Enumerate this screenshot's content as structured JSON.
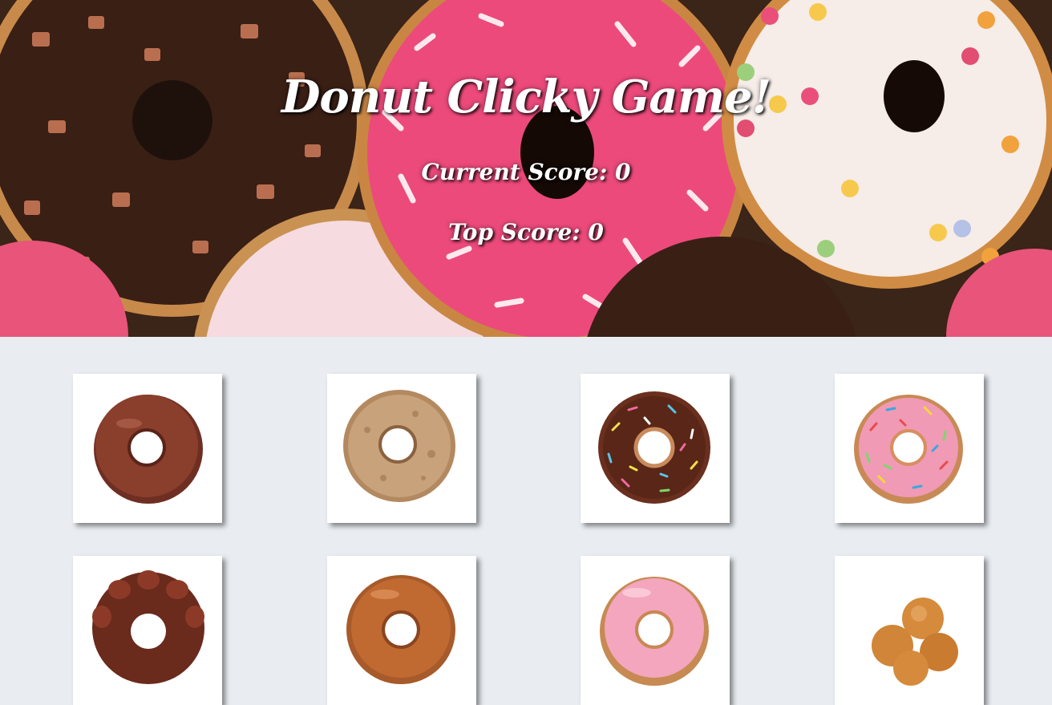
{
  "header": {
    "title": "Donut Clicky Game!",
    "current_score_label": "Current Score: 0",
    "top_score_label": "Top Score: 0"
  },
  "donuts": [
    {
      "name": "chocolate-glazed-donut-image"
    },
    {
      "name": "glazed-cake-donut-image"
    },
    {
      "name": "chocolate-sprinkle-donut-image"
    },
    {
      "name": "pink-sprinkle-donut-image"
    },
    {
      "name": "chocolate-cruller-donut-image"
    },
    {
      "name": "caramel-glazed-donut-image"
    },
    {
      "name": "pink-frosted-donut-image"
    },
    {
      "name": "donut-holes-image"
    }
  ],
  "colors": {
    "page_background": "#e9edf1",
    "card_background": "#ffffff",
    "header_text": "#ffffff"
  }
}
